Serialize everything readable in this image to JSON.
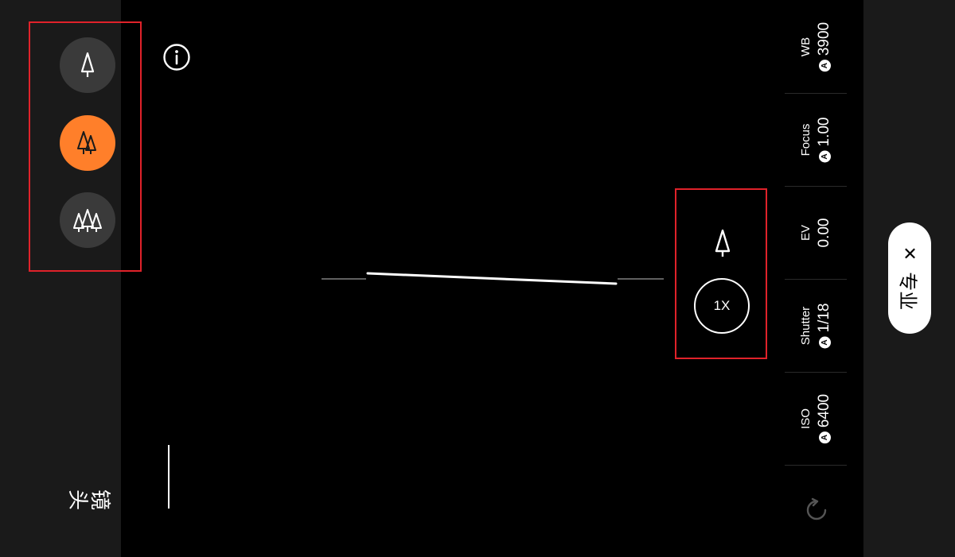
{
  "lens": {
    "label": "镜头",
    "options": [
      {
        "name": "single-tree",
        "icon": "single-tree-icon",
        "active": false
      },
      {
        "name": "double-tree",
        "icon": "double-tree-icon",
        "active": true
      },
      {
        "name": "triple-tree",
        "icon": "triple-tree-icon",
        "active": false
      }
    ]
  },
  "zoom": {
    "label": "1X"
  },
  "settings": [
    {
      "name": "WB",
      "value": "3900",
      "auto": "A"
    },
    {
      "name": "Focus",
      "value": "1.00",
      "auto": "A"
    },
    {
      "name": "EV",
      "value": "0.00",
      "auto": ""
    },
    {
      "name": "Shutter",
      "value": "1/18",
      "auto": "A"
    },
    {
      "name": "ISO",
      "value": "6400",
      "auto": "A"
    }
  ],
  "mode": {
    "label": "专业",
    "close": "✕"
  },
  "colors": {
    "accent": "#ff7f2a",
    "highlight": "#e0222a",
    "panel": "#1a1a1a"
  }
}
